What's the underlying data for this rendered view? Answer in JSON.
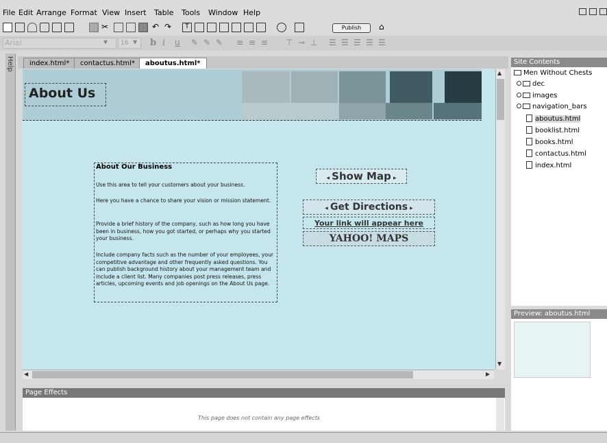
{
  "menu": [
    "File",
    "Edit",
    "Arrange",
    "Format",
    "View",
    "Insert",
    "Table",
    "Tools",
    "Window",
    "Help"
  ],
  "toolbar": {
    "publish_label": "Publish"
  },
  "format": {
    "font": "Arial",
    "size": "16"
  },
  "help_label": "Help",
  "tabs": [
    {
      "label": "index.html*"
    },
    {
      "label": "contactus.html*"
    },
    {
      "label": "aboutus.html*"
    }
  ],
  "page": {
    "heading": "About Us",
    "section_title": "About Our Business",
    "paragraphs": [
      "Use this area to tell your customers about your business.",
      "Here you have a chance to share your vision or mission statement.",
      "Provide a brief history of the company, such as how long you have been in business, how you got started, or perhaps why you started your business.",
      "Include company facts such as the number of your employees, your competitive advantage and other frequently asked questions. You can publish background history about your management team and include a client list. Many companies post press releases, press articles, upcoming events and job openings on the About Us page."
    ],
    "show_map": "Show Map",
    "get_directions": "Get Directions",
    "link_placeholder": "Your link will appear here",
    "yahoo_maps": "YAHOO! MAPS"
  },
  "page_effects": {
    "title": "Page Effects",
    "message": "This page does not contain any page effects"
  },
  "site": {
    "title": "Site Contents",
    "root": "Men Without Chests",
    "folders": [
      "dec",
      "images",
      "navigation_bars"
    ],
    "files": [
      "aboutus.html",
      "booklist.html",
      "books.html",
      "contactus.html",
      "index.html"
    ],
    "selected": "aboutus.html"
  },
  "preview": {
    "title": "Preview: aboutus.html"
  },
  "colors": {
    "editor_bg": "#c6e6ed",
    "header_bg": "#afcdd6"
  }
}
